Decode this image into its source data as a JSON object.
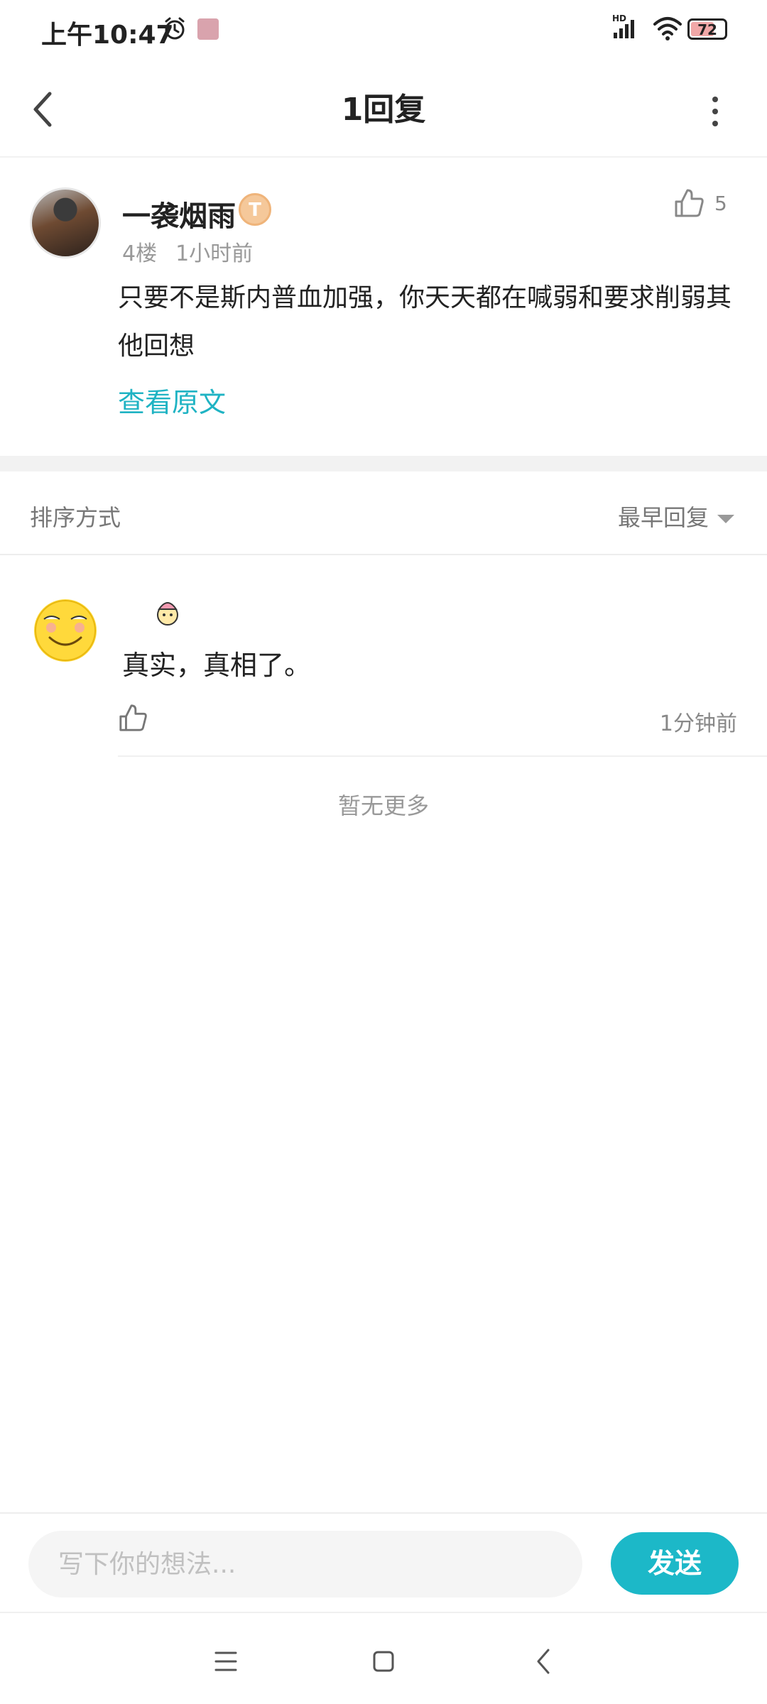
{
  "status_bar": {
    "time": "上午10:47",
    "battery": "72",
    "battery_level": 0.72,
    "icons": [
      "alarm-icon",
      "app-notification-icon",
      "hd-signal-icon",
      "wifi-icon",
      "battery-icon"
    ]
  },
  "header": {
    "title": "1回复",
    "icons": [
      "back-arrow-icon",
      "more-vertical-icon"
    ]
  },
  "original_comment": {
    "username": "一袭烟雨",
    "level_badge": "T",
    "like_count": "5",
    "floor": "4楼",
    "time": "1小时前",
    "text": "只要不是斯内普血加强，你天天都在喊弱和要求削弱其他回想",
    "view_original": "查看原文"
  },
  "sort": {
    "label": "排序方式",
    "selected": "最早回复"
  },
  "reply": {
    "text": "真实，真相了。",
    "time": "1分钟前"
  },
  "no_more": "暂无更多",
  "input": {
    "placeholder": "写下你的想法...",
    "send_label": "发送"
  },
  "colors": {
    "accent": "#1cb8c8",
    "link": "#1fb3c3",
    "muted": "#999999"
  }
}
